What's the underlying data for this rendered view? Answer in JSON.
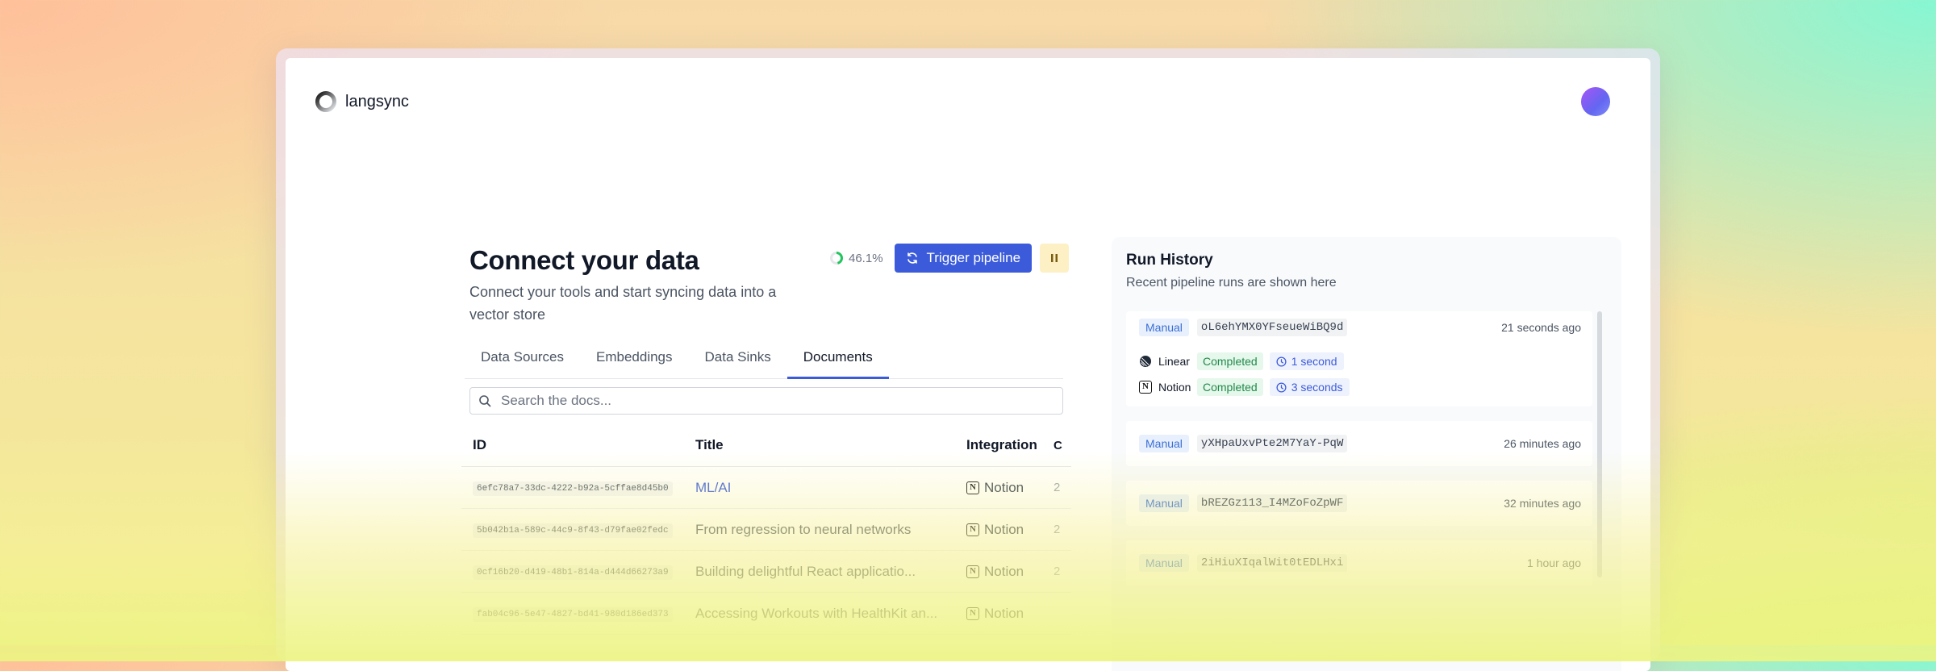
{
  "app": {
    "name": "langsync"
  },
  "page": {
    "title": "Connect your data",
    "subtitle": "Connect your tools and start syncing data into a vector store",
    "progress": "46.1%",
    "progress_fraction": 0.461,
    "trigger_label": "Trigger pipeline"
  },
  "tabs": [
    {
      "label": "Data Sources"
    },
    {
      "label": "Embeddings"
    },
    {
      "label": "Data Sinks"
    },
    {
      "label": "Documents",
      "active": true
    }
  ],
  "search": {
    "placeholder": "Search the docs..."
  },
  "table": {
    "headers": {
      "id": "ID",
      "title": "Title",
      "integration": "Integration"
    },
    "rows": [
      {
        "id": "6efc78a7-33dc-4222-b92a-5cffae8d45b0",
        "title": "ML/AI",
        "integration": "Notion",
        "extra": "2"
      },
      {
        "id": "5b042b1a-589c-44c9-8f43-d79fae02fedc",
        "title": "From regression to neural networks",
        "integration": "Notion",
        "extra": "2"
      },
      {
        "id": "0cf16b20-d419-48b1-814a-d444d66273a9",
        "title": "Building delightful React applicatio...",
        "integration": "Notion",
        "extra": "2"
      },
      {
        "id": "fab04c96-5e47-4827-bd41-980d186ed373",
        "title": "Accessing Workouts with HealthKit an...",
        "integration": "Notion",
        "extra": ""
      }
    ]
  },
  "history": {
    "title": "Run History",
    "subtitle": "Recent pipeline runs are shown here",
    "runs": [
      {
        "trigger": "Manual",
        "id": "oL6ehYMX0YFseueWiBQ9d",
        "time": "21 seconds ago",
        "integrations": [
          {
            "name": "Linear",
            "status": "Completed",
            "duration": "1 second"
          },
          {
            "name": "Notion",
            "status": "Completed",
            "duration": "3 seconds"
          }
        ]
      },
      {
        "trigger": "Manual",
        "id": "yXHpaUxvPte2M7YaY-PqW",
        "time": "26 minutes ago"
      },
      {
        "trigger": "Manual",
        "id": "bREZGz113_I4MZoFoZpWF",
        "time": "32 minutes ago"
      },
      {
        "trigger": "Manual",
        "id": "2iHiuXIqalWit0tEDLHxi",
        "time": "1 hour ago"
      }
    ]
  },
  "colors": {
    "accent": "#3b5bdb",
    "success": "#1f8a48",
    "pause_bg": "#fdf0c4"
  },
  "icons": {
    "logo": "spinner-logo",
    "trigger": "refresh-icon",
    "pause": "pause-icon",
    "search": "search-icon",
    "notion": "notion-icon",
    "linear": "linear-icon",
    "clock": "clock-icon"
  }
}
